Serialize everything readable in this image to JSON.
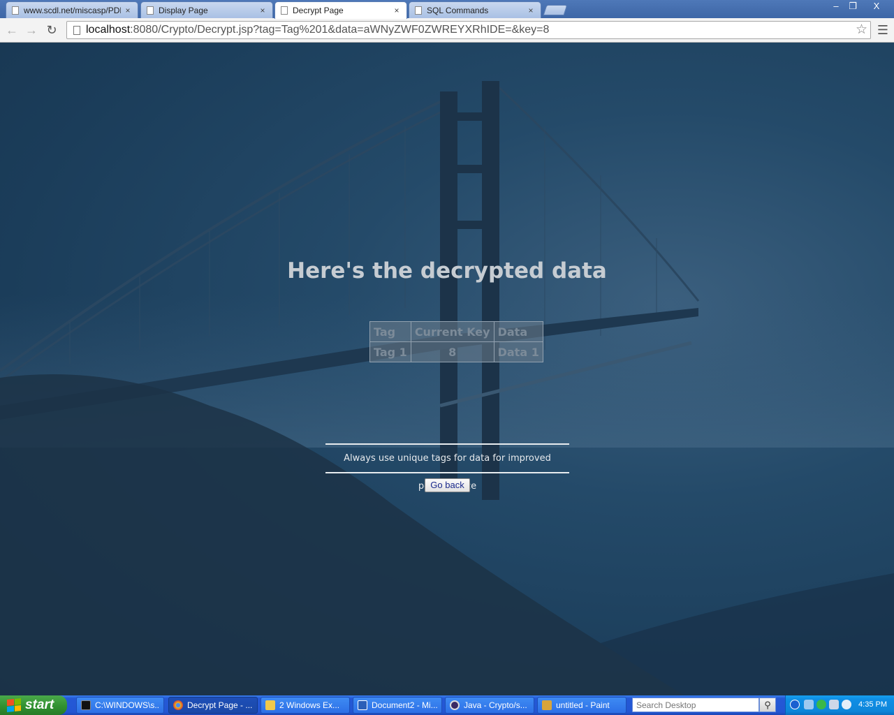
{
  "browser": {
    "tabs": [
      {
        "title": "www.scdl.net/miscasp/PDFS",
        "active": false
      },
      {
        "title": "Display Page",
        "active": false
      },
      {
        "title": "Decrypt Page",
        "active": true
      },
      {
        "title": "SQL Commands",
        "active": false
      }
    ],
    "tab_close_glyph": "×",
    "url_host": "localhost",
    "url_rest": ":8080/Crypto/Decrypt.jsp?tag=Tag%201&data=aWNyZWF0ZWREYXRhIDE=&key=8",
    "window_controls": {
      "minimize": "‒",
      "maximize": "❐",
      "close": "X"
    }
  },
  "page": {
    "heading": "Here's the decrypted data",
    "table": {
      "headers": [
        "Tag",
        "Current Key",
        "Data"
      ],
      "rows": [
        [
          "Tag 1",
          "8",
          "Data 1"
        ]
      ]
    },
    "notice": "Always use unique tags for data for improved performance",
    "back_button": "Go back"
  },
  "taskbar": {
    "start_label": "start",
    "tasks": [
      {
        "label": "C:\\WINDOWS\\s...",
        "icon": "cmd-icon",
        "color": "#111111"
      },
      {
        "label": "Decrypt Page - ...",
        "icon": "chrome-icon",
        "color": "#e8b923"
      },
      {
        "label": "2 Windows Ex...",
        "icon": "folder-icon",
        "color": "#f0c94a"
      },
      {
        "label": "Document2 - Mi...",
        "icon": "word-icon",
        "color": "#2b5fb8"
      },
      {
        "label": "Java - Crypto/s...",
        "icon": "eclipse-icon",
        "color": "#3a2a66"
      },
      {
        "label": "untitled - Paint",
        "icon": "paint-icon",
        "color": "#d8a43a"
      }
    ],
    "search_placeholder": "Search Desktop",
    "clock": "4:35 PM"
  },
  "colors": {
    "page_bg": "#1b3d5a",
    "heading": "#c6ccd2",
    "table_text": "#7c8b99",
    "taskbar": "#2356d3",
    "start": "#2f8f2f"
  }
}
